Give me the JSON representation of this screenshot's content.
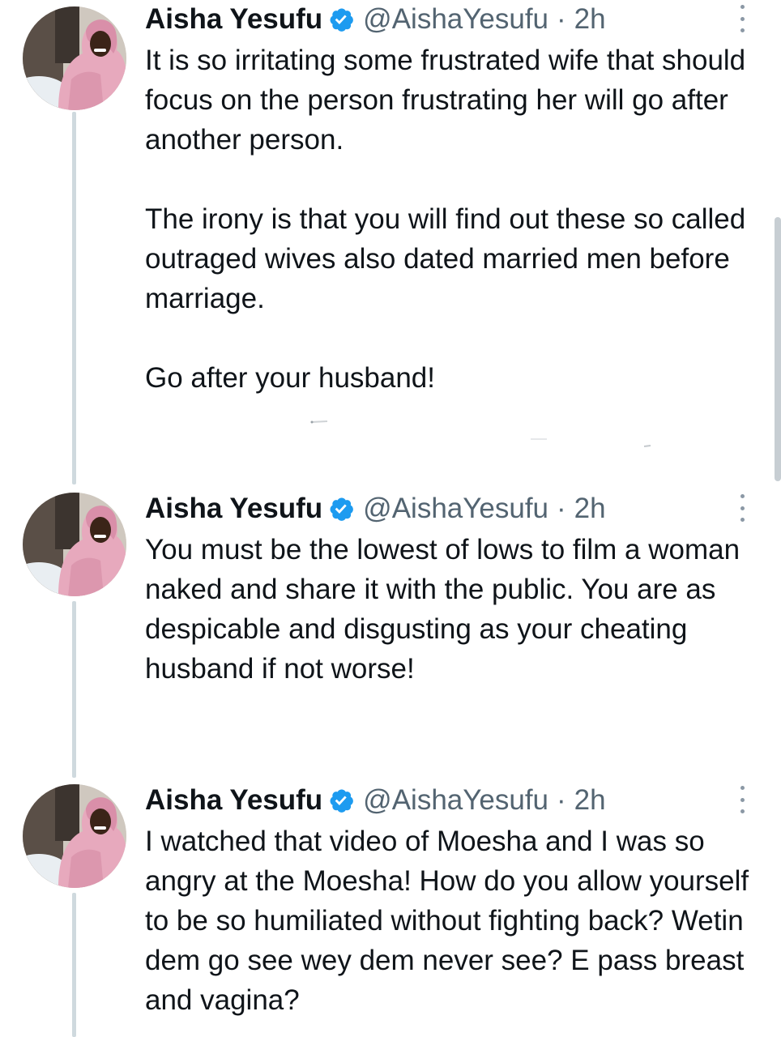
{
  "colors": {
    "text": "#0f1419",
    "secondary": "#536471",
    "verified": "#1d9bf0",
    "thread_line": "#cfd9de"
  },
  "tweets": [
    {
      "author": {
        "name": "Aisha Yesufu",
        "handle": "@AishaYesufu",
        "verified_icon": "verified-badge-icon",
        "avatar_icon": "profile-photo"
      },
      "separator": "·",
      "time": "2h",
      "paragraphs": [
        "It is so irritating some frustrated wife that should focus on the person frustrating her will go after another person.",
        "The irony is that you will find out these so called outraged wives also dated married men before marriage.",
        "Go after your husband!"
      ],
      "menu_icon": "more-options-icon"
    },
    {
      "author": {
        "name": "Aisha Yesufu",
        "handle": "@AishaYesufu",
        "verified_icon": "verified-badge-icon",
        "avatar_icon": "profile-photo"
      },
      "separator": "·",
      "time": "2h",
      "paragraphs": [
        "You must be the lowest of lows to film a woman naked and share it with the public. You are as despicable and disgusting as your cheating husband if not worse!"
      ],
      "menu_icon": "more-options-icon"
    },
    {
      "author": {
        "name": "Aisha Yesufu",
        "handle": "@AishaYesufu",
        "verified_icon": "verified-badge-icon",
        "avatar_icon": "profile-photo"
      },
      "separator": "·",
      "time": "2h",
      "paragraphs": [
        "I watched that video of Moesha and I was so angry at the Moesha! How do you allow yourself to be so humiliated without fighting back? Wetin dem go see wey dem never see? E pass breast and vagina?"
      ],
      "menu_icon": "more-options-icon"
    }
  ]
}
